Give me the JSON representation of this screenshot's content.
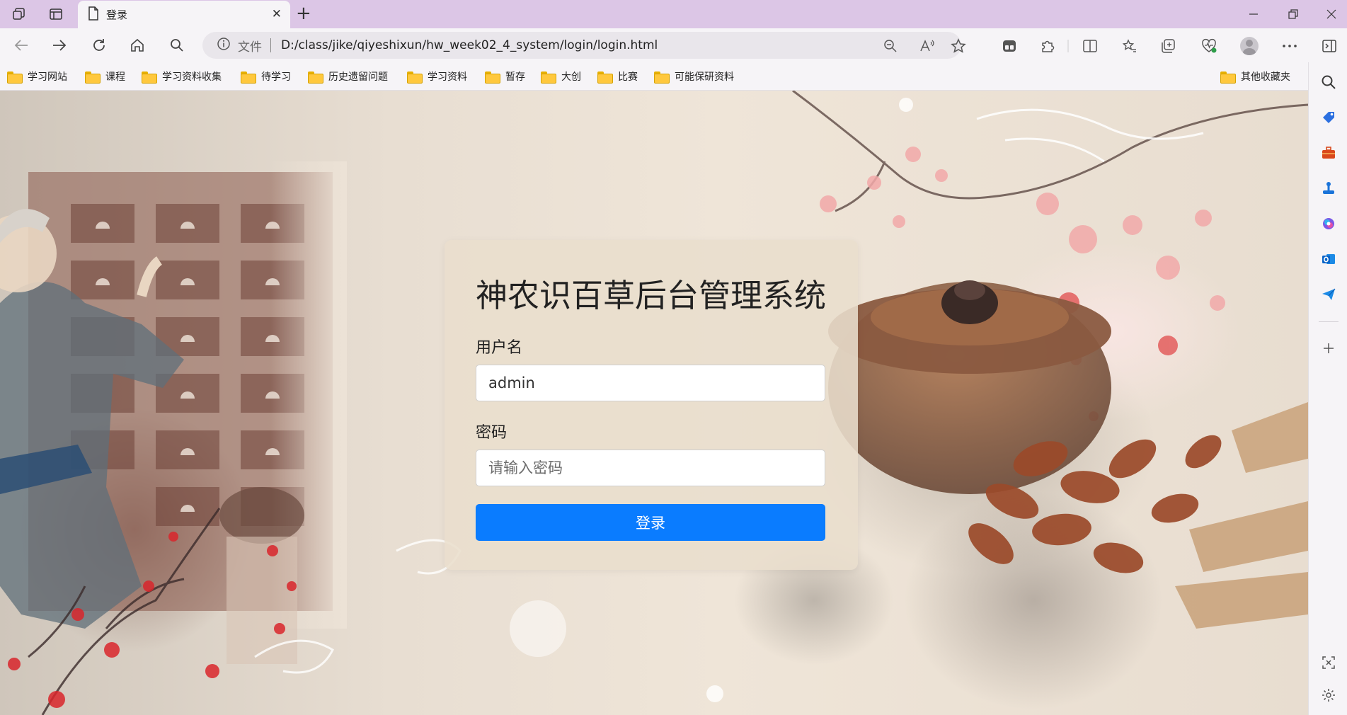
{
  "browser": {
    "tab": {
      "title": "登录"
    },
    "address": {
      "security_label": "文件",
      "url": "D:/class/jike/qiyeshixun/hw_week02_4_system/login/login.html"
    },
    "bookmarks": [
      "学习网站",
      "课程",
      "学习资料收集",
      "待学习",
      "历史遗留问题",
      "学习资料",
      "暂存",
      "大创",
      "比赛",
      "可能保研资料"
    ],
    "other_bookmarks": "其他收藏夹",
    "colors": {
      "tabbar": "#dcc6e6",
      "toolbar": "#f6f4f7",
      "folder": "#ffc83d"
    },
    "icons": {
      "tabbar": [
        "workspaces-icon",
        "vertical-tabs-icon",
        "page-icon",
        "close-icon",
        "plus-icon",
        "minimize-icon",
        "restore-icon",
        "window-close-icon"
      ],
      "toolbar": [
        "back-icon",
        "forward-icon",
        "refresh-icon",
        "home-icon",
        "search-icon",
        "info-icon",
        "zoom-out-icon",
        "read-aloud-icon",
        "favorite-star-icon",
        "extension-app-icon",
        "puzzle-extensions-icon",
        "split-screen-icon",
        "favorites-icon",
        "collections-icon",
        "browser-essentials-icon",
        "profile-avatar",
        "more-icon",
        "sidebar-toggle-icon"
      ],
      "sidebar": [
        "search-icon",
        "tag-icon",
        "toolbox-icon",
        "games-icon",
        "copilot-icon",
        "outlook-icon",
        "send-icon",
        "add-icon",
        "screenshot-icon",
        "settings-icon"
      ]
    }
  },
  "login": {
    "title": "神农识百草后台管理系统",
    "username_label": "用户名",
    "username_value": "admin",
    "password_label": "密码",
    "password_placeholder": "请输入密码",
    "submit_label": "登录",
    "accent_color": "#0a7cff"
  }
}
